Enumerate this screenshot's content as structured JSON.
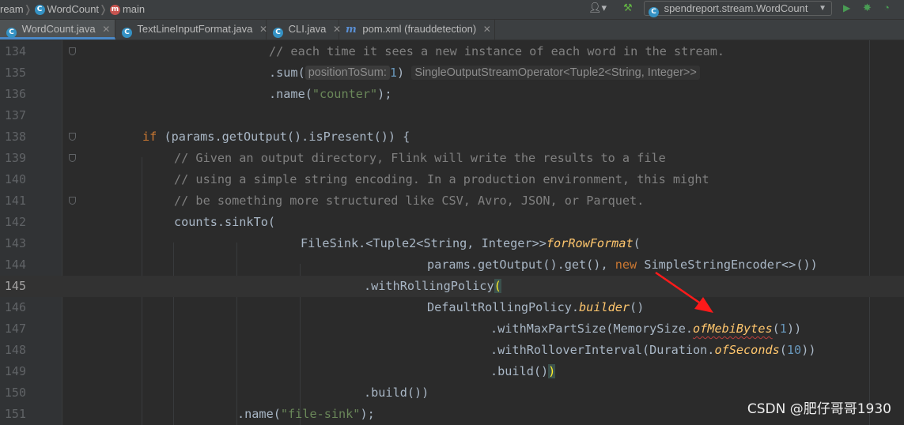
{
  "navbar": {
    "crumb_partial": "ream",
    "crumb_class": "WordCount",
    "crumb_method": "main",
    "run_config": "spendreport.stream.WordCount"
  },
  "tabs": [
    {
      "label": "WordCount.java",
      "icon": "class-icon"
    },
    {
      "label": "TextLineInputFormat.java",
      "icon": "class-icon"
    },
    {
      "label": "CLI.java",
      "icon": "class-icon"
    },
    {
      "label": "pom.xml (frauddetection)",
      "icon": "maven-icon"
    }
  ],
  "editor": {
    "current_line": 145,
    "line_numbers": [
      "134",
      "135",
      "136",
      "137",
      "138",
      "139",
      "140",
      "141",
      "142",
      "143",
      "144",
      "145",
      "146",
      "147",
      "148",
      "149",
      "150",
      "151"
    ],
    "code": {
      "l134_comment": "// each time it sees a new instance of each word in the stream.",
      "l135_call": ".sum(",
      "l135_hint_param": "positionToSum:",
      "l135_arg": "1",
      "l135_close": ")",
      "l135_type_hint": "SingleOutputStreamOperator<Tuple2<String, Integer>>",
      "l136_call": ".name(",
      "l136_str": "\"counter\"",
      "l136_end": ");",
      "l138_if": "if",
      "l138_rest": " (params.getOutput().isPresent()) {",
      "l139_comment": "// Given an output directory, Flink will write the results to a file",
      "l140_comment": "// using a simple string encoding. In a production environment, this might",
      "l141_comment": "// be something more structured like CSV, Avro, JSON, or Parquet.",
      "l142_code": "counts.sinkTo(",
      "l143_prefix": "FileSink.<Tuple2<String, Integer>>",
      "l143_method": "forRowFormat",
      "l143_paren": "(",
      "l144_code": "params.getOutput().get(), ",
      "l144_new": "new",
      "l144_rest": " SimpleStringEncoder<>())",
      "l145_code": ".withRollingPolicy",
      "l145_paren": "(",
      "l146_code": "DefaultRollingPolicy.",
      "l146_method": "builder",
      "l146_rest": "()",
      "l147_code": ".withMaxPartSize(MemorySize.",
      "l147_method": "ofMebiBytes",
      "l147_open": "(",
      "l147_num": "1",
      "l147_close": "))",
      "l148_code": ".withRolloverInterval(Duration.",
      "l148_method": "ofSeconds",
      "l148_open": "(",
      "l148_num": "10",
      "l148_close": "))",
      "l149_code": ".build()",
      "l149_close": ")",
      "l150_code": ".build())",
      "l151_call": ".name(",
      "l151_str": "\"file-sink\"",
      "l151_end": ");"
    }
  },
  "watermark": "CSDN @肥仔哥哥1930",
  "colors": {
    "background": "#2b2b2b",
    "gutter": "#313335",
    "keyword": "#cc7832",
    "string": "#6a8759",
    "comment": "#808080",
    "method_static": "#ffc66d",
    "number": "#6897bb",
    "annotation_arrow": "#ff1a1a"
  }
}
